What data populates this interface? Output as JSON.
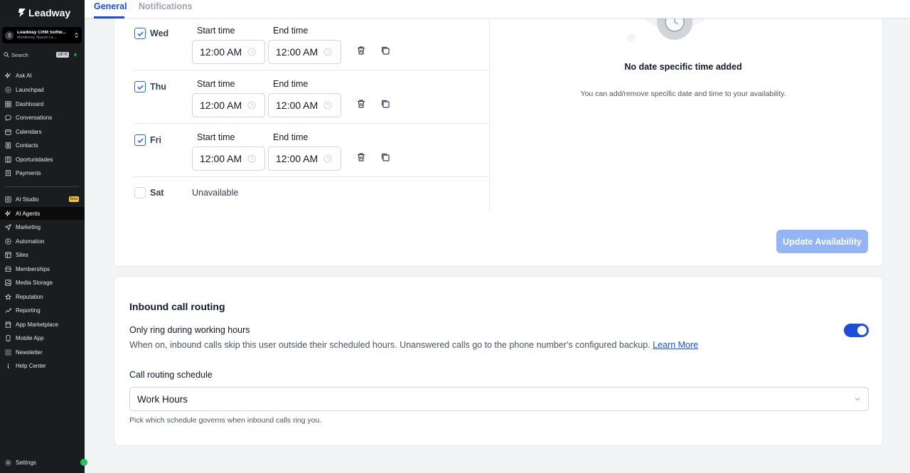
{
  "brand": {
    "name": "Leadway"
  },
  "account": {
    "name": "Leadway CRM Softw...",
    "location": "Monterrey, Nuevo Le..."
  },
  "search": {
    "label": "Search",
    "shortcut": "ctrl K"
  },
  "sidebar": {
    "items": [
      {
        "label": "Ask AI",
        "icon": "sparkle-icon"
      },
      {
        "label": "Launchpad",
        "icon": "rocket-icon"
      },
      {
        "label": "Dashboard",
        "icon": "grid-icon"
      },
      {
        "label": "Conversations",
        "icon": "chat-icon"
      },
      {
        "label": "Calendars",
        "icon": "calendar-icon"
      },
      {
        "label": "Contacts",
        "icon": "contacts-icon"
      },
      {
        "label": "Oportunidades",
        "icon": "filter-icon"
      },
      {
        "label": "Payments",
        "icon": "receipt-icon"
      },
      {
        "label": "AI Studio",
        "icon": "studio-icon",
        "badge": "Beta"
      },
      {
        "label": "AI Agents",
        "icon": "sparkle-icon"
      },
      {
        "label": "Marketing",
        "icon": "send-icon"
      },
      {
        "label": "Automation",
        "icon": "automation-icon"
      },
      {
        "label": "Sites",
        "icon": "sites-icon"
      },
      {
        "label": "Memberships",
        "icon": "membership-icon"
      },
      {
        "label": "Media Storage",
        "icon": "media-icon"
      },
      {
        "label": "Reputation",
        "icon": "star-icon"
      },
      {
        "label": "Reporting",
        "icon": "chart-icon"
      },
      {
        "label": "App Marketplace",
        "icon": "marketplace-icon"
      },
      {
        "label": "Mobile App",
        "icon": "mobile-icon"
      },
      {
        "label": "Newsletter",
        "icon": "newsletter-icon"
      },
      {
        "label": "Help Center",
        "icon": "info-icon"
      }
    ],
    "settings": "Settings"
  },
  "tabs": [
    {
      "label": "General",
      "active": true
    },
    {
      "label": "Notifications",
      "active": false
    }
  ],
  "availability": {
    "start_label": "Start time",
    "end_label": "End time",
    "days": [
      {
        "day": "Wed",
        "checked": true,
        "start": "12:00 AM",
        "end": "12:00 AM"
      },
      {
        "day": "Thu",
        "checked": true,
        "start": "12:00 AM",
        "end": "12:00 AM"
      },
      {
        "day": "Fri",
        "checked": true,
        "start": "12:00 AM",
        "end": "12:00 AM"
      },
      {
        "day": "Sat",
        "checked": false,
        "status": "Unavailable"
      }
    ],
    "no_date_title": "No date specific time added",
    "no_date_sub": "You can add/remove specific date and time to your availability.",
    "update_button": "Update Availability"
  },
  "inbound": {
    "title": "Inbound call routing",
    "ring_label": "Only ring during working hours",
    "ring_desc": "When on, inbound calls skip this user outside their scheduled hours. Unanswered calls go to the phone number's configured backup.",
    "learn_more": "Learn More",
    "ring_enabled": true,
    "schedule_label": "Call routing schedule",
    "schedule_value": "Work Hours",
    "schedule_help": "Pick which schedule governs when inbound calls ring you."
  },
  "colors": {
    "accent": "#1d4ed8",
    "sidebar_bg": "#1b1c1f",
    "button_disabled": "#93b4f5",
    "beta_badge": "#f5c542"
  }
}
